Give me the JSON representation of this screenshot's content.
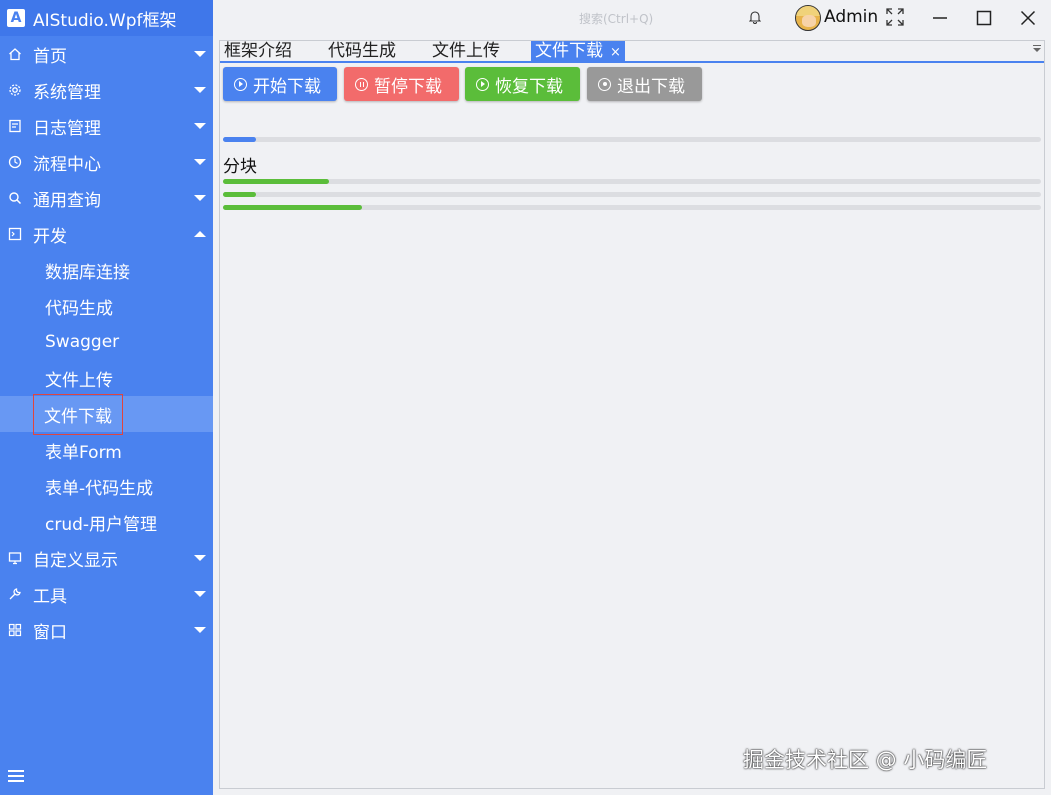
{
  "app": {
    "title": "AIStudio.Wpf框架",
    "logo": "A"
  },
  "sidebar": {
    "items": [
      {
        "label": "首页",
        "icon": "home-icon"
      },
      {
        "label": "系统管理",
        "icon": "gear-icon"
      },
      {
        "label": "日志管理",
        "icon": "log-icon"
      },
      {
        "label": "流程中心",
        "icon": "clock-icon"
      },
      {
        "label": "通用查询",
        "icon": "search-icon"
      },
      {
        "label": "开发",
        "icon": "terminal-icon",
        "expanded": true
      }
    ],
    "sub_items": [
      {
        "label": "数据库连接"
      },
      {
        "label": "代码生成"
      },
      {
        "label": "Swagger"
      },
      {
        "label": "文件上传"
      },
      {
        "label": "文件下载",
        "active": true
      },
      {
        "label": "表单Form"
      },
      {
        "label": "表单-代码生成"
      },
      {
        "label": "crud-用户管理"
      }
    ],
    "bottom_items": [
      {
        "label": "自定义显示",
        "icon": "monitor-icon"
      },
      {
        "label": "工具",
        "icon": "wrench-icon"
      },
      {
        "label": "窗口",
        "icon": "windows-icon"
      }
    ],
    "colors": {
      "background": "#4a82ef",
      "active": "#6898f3"
    }
  },
  "topbar": {
    "search_placeholder": "搜索(Ctrl+Q)",
    "user": "Admin"
  },
  "tabs": [
    {
      "label": "框架介绍"
    },
    {
      "label": "代码生成"
    },
    {
      "label": "文件上传"
    },
    {
      "label": "文件下载",
      "active": true,
      "close": "×"
    }
  ],
  "buttons": {
    "start": {
      "label": "开始下载",
      "color": "#4a82ef"
    },
    "pause": {
      "label": "暂停下载",
      "color": "#f26b6b"
    },
    "resume": {
      "label": "恢复下载",
      "color": "#5bbd3a"
    },
    "exit": {
      "label": "退出下载",
      "color": "#999999"
    }
  },
  "progress": {
    "overall": 0.04,
    "chunk_label": "分块",
    "chunks": [
      0.13,
      0.04,
      0.17
    ],
    "colors": {
      "overall": "#4a82ef",
      "chunk": "#5bbd3a",
      "track": "#dcdde1"
    }
  },
  "watermark": "掘金技术社区 @ 小码编匠"
}
